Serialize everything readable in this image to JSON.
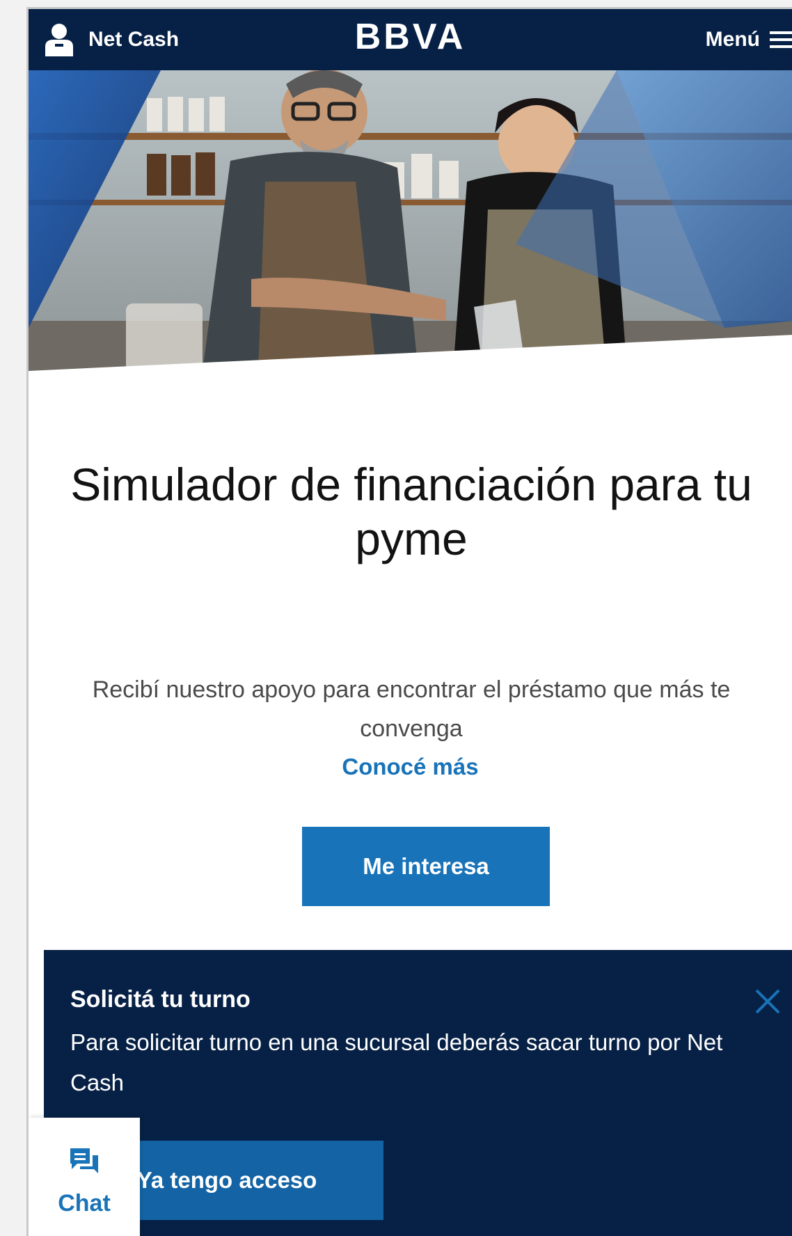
{
  "header": {
    "account_label": "Net Cash",
    "brand": "BBVA",
    "menu_label": "Menú",
    "background_color": "#072146"
  },
  "hero": {
    "image_alt": "Two smiling café workers in aprons preparing drinks behind a counter"
  },
  "main": {
    "title": "Simulador de financiación para tu pyme",
    "subtitle": "Recibí nuestro apoyo para encontrar el préstamo que más te convenga",
    "link_label": "Conocé más",
    "cta_label": "Me interesa",
    "accent_color": "#1973b8"
  },
  "notice": {
    "title": "Solicitá tu turno",
    "text": "Para solicitar turno en una sucursal deberás sacar turno por Net Cash",
    "button_label": "Ya tengo acceso",
    "close_icon": "close-icon"
  },
  "chat": {
    "label": "Chat",
    "icon": "chat-bubble-icon"
  }
}
